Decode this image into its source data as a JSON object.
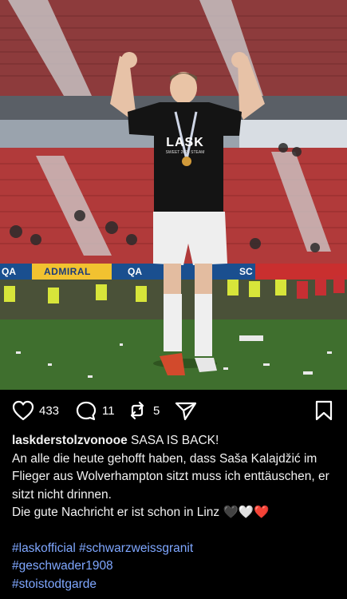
{
  "post": {
    "photo_alt": "Player celebrating in stadium",
    "shirt_text": "LASK",
    "shirt_sub": "SWEET 2024 STEAM",
    "banner_left": "QA",
    "banner_mid": "ADMIRAL",
    "banner_right": "QA",
    "banner_far_right": "SC"
  },
  "actions": {
    "likes": "433",
    "comments": "11",
    "reposts": "5"
  },
  "caption": {
    "username": "laskderstolzvonooe",
    "headline": "SASA IS BACK!",
    "body": "An alle die heute gehofft haben, dass Saša Kalajdžić im Flieger aus Wolverhampton sitzt muss ich enttäuschen, er sitzt nicht drinnen.",
    "line2": "Die gute Nachricht er ist schon in Linz 🖤🤍❤️",
    "hashtags": [
      "#laskofficial",
      "#schwarzweissgranit",
      "#geschwader1908",
      "#stoistodtgarde"
    ]
  },
  "colors": {
    "link": "#7fa7ff",
    "seat_red": "#b13a3a",
    "pitch": "#3f6f2e"
  }
}
